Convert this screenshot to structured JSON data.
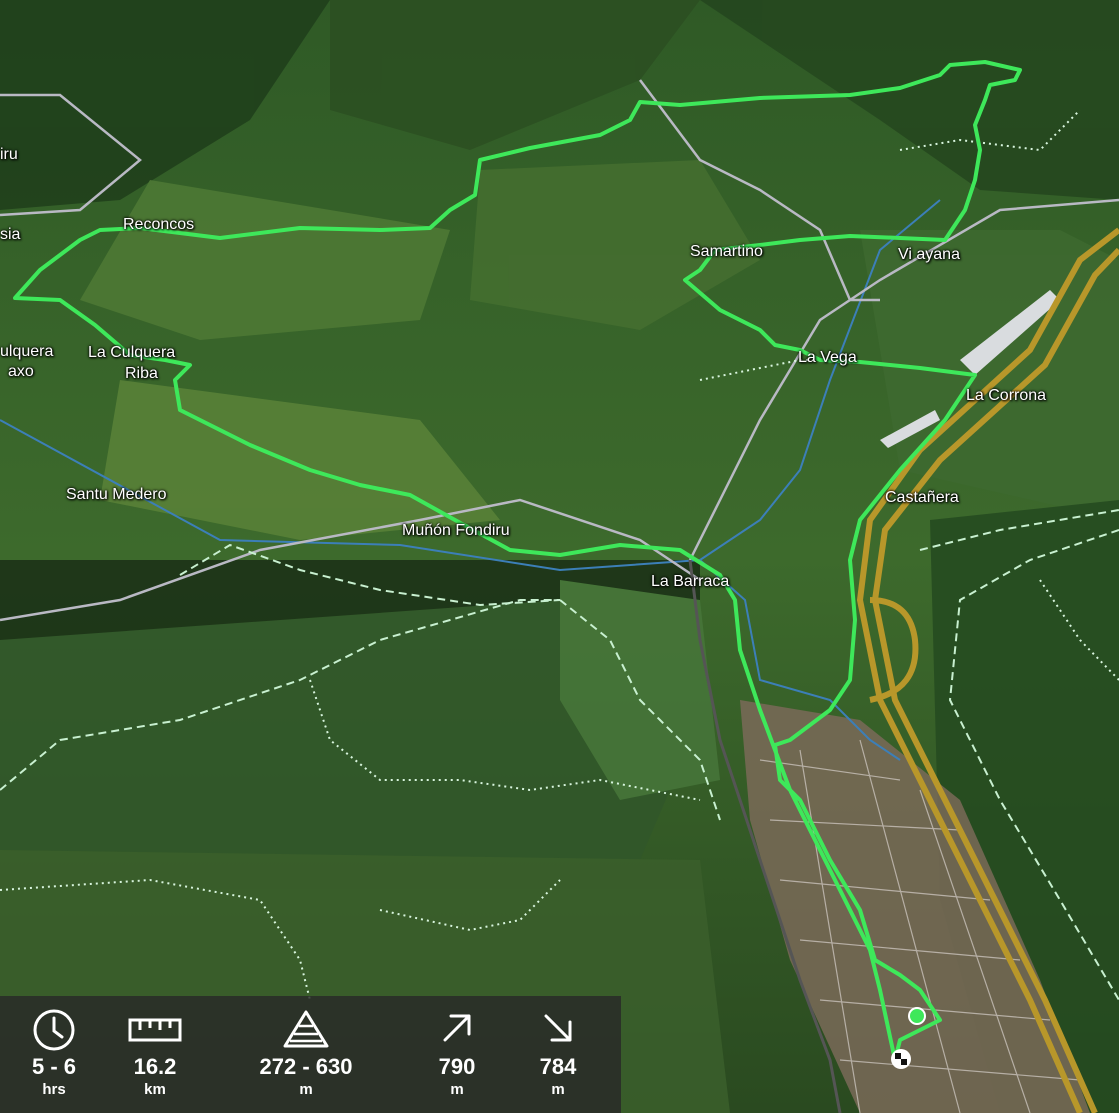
{
  "map": {
    "places": [
      {
        "id": "iru",
        "name": "iru"
      },
      {
        "id": "sia",
        "name": "sia"
      },
      {
        "id": "reconcos",
        "name": "Reconcos"
      },
      {
        "id": "culquera",
        "name": "ulquera"
      },
      {
        "id": "axo",
        "name": "axo"
      },
      {
        "id": "la-culquera",
        "name": "La Culquera"
      },
      {
        "id": "riba",
        "name": "Riba"
      },
      {
        "id": "santu-medero",
        "name": "Santu Medero"
      },
      {
        "id": "munon-fondiru",
        "name": "Muñón Fondiru"
      },
      {
        "id": "la-barraca",
        "name": "La Barraca"
      },
      {
        "id": "samartino",
        "name": "Samartino"
      },
      {
        "id": "viayana",
        "name": "Vi  ayana"
      },
      {
        "id": "la-vega",
        "name": "La Vega"
      },
      {
        "id": "la-corrona",
        "name": "La Corrona"
      },
      {
        "id": "castanera",
        "name": "Castañera"
      }
    ],
    "route_color": "#3ee85a",
    "trail_color": "#c8f0d0",
    "highway_color": "#b8972a"
  },
  "stats": {
    "duration": {
      "icon": "clock-icon",
      "value": "5 - 6",
      "unit": "hrs"
    },
    "distance": {
      "icon": "ruler-icon",
      "value": "16.2",
      "unit": "km"
    },
    "elevation": {
      "icon": "elevation-icon",
      "value": "272 - 630",
      "unit": "m"
    },
    "ascent": {
      "icon": "arrow-up-right-icon",
      "value": "790",
      "unit": "m"
    },
    "descent": {
      "icon": "arrow-down-right-icon",
      "value": "784",
      "unit": "m"
    }
  }
}
